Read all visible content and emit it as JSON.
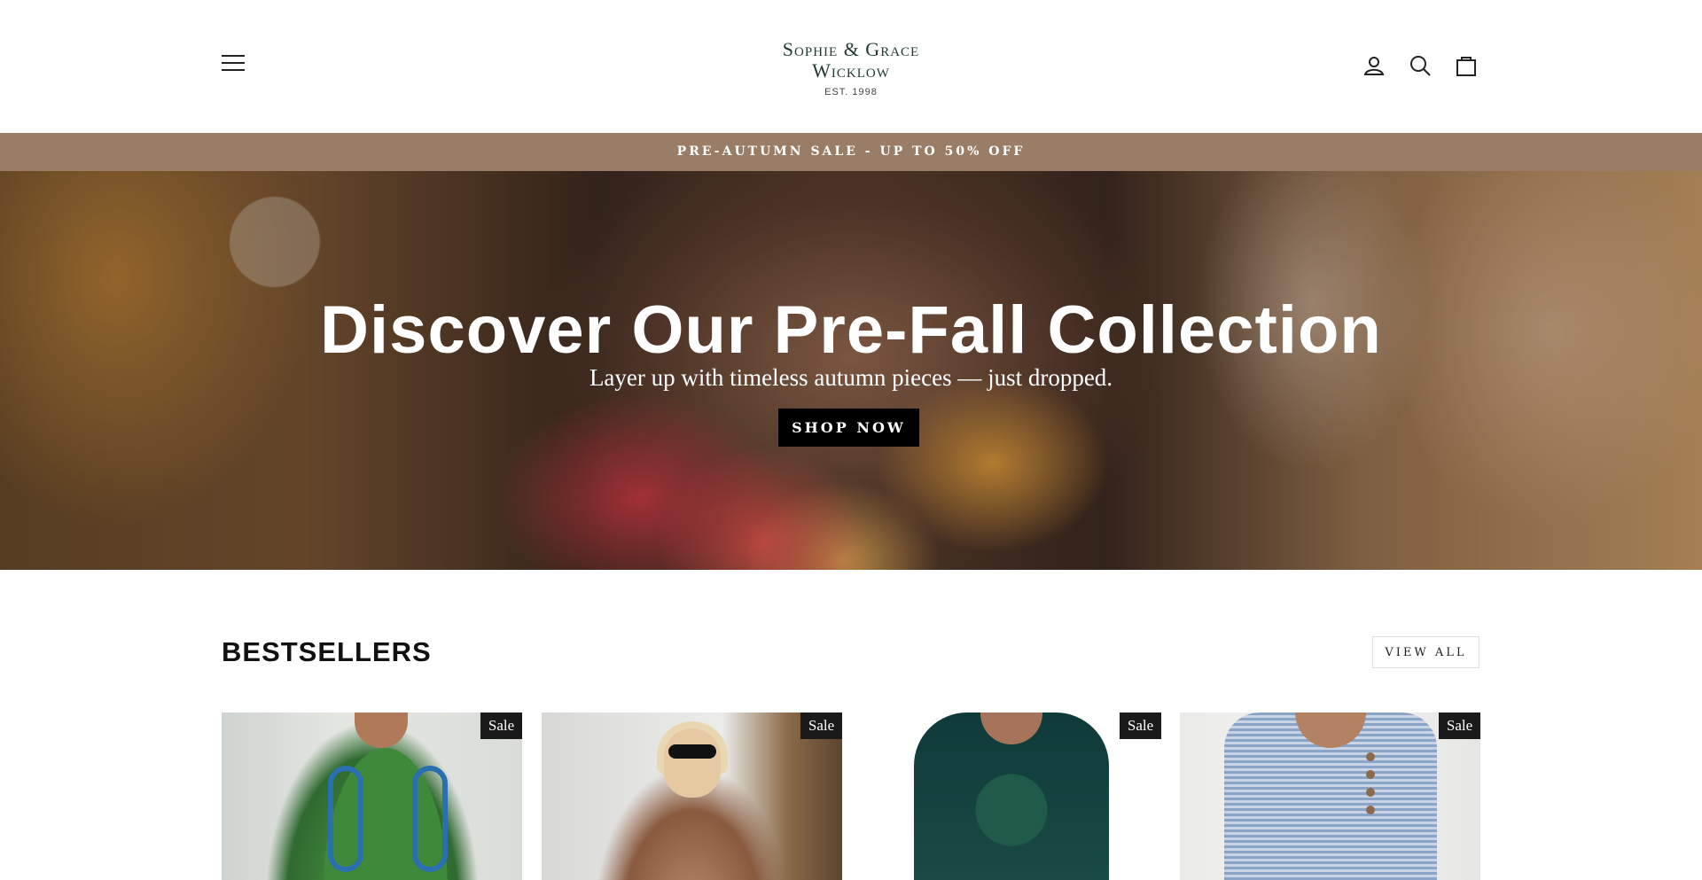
{
  "brand": {
    "line1": "Sophie & Grace",
    "line2": "Wicklow",
    "est": "EST. 1998"
  },
  "header": {
    "icons": [
      "menu-icon",
      "account-icon",
      "search-icon",
      "cart-icon"
    ]
  },
  "announcement": {
    "text": "PRE-AUTUMN SALE - UP TO 50% OFF"
  },
  "hero": {
    "title": "Discover Our Pre-Fall Collection",
    "subtitle": "Layer up with timeless autumn pieces — just dropped.",
    "cta": "SHOP NOW"
  },
  "bestsellers": {
    "title": "BESTSELLERS",
    "view_all": "VIEW ALL",
    "products": [
      {
        "badge": "Sale"
      },
      {
        "badge": "Sale"
      },
      {
        "badge": "Sale"
      },
      {
        "badge": "Sale"
      }
    ]
  },
  "colors": {
    "announcement_bg": "#9a7d66",
    "logo_green": "#1f3a2e",
    "button_black": "#000000"
  }
}
